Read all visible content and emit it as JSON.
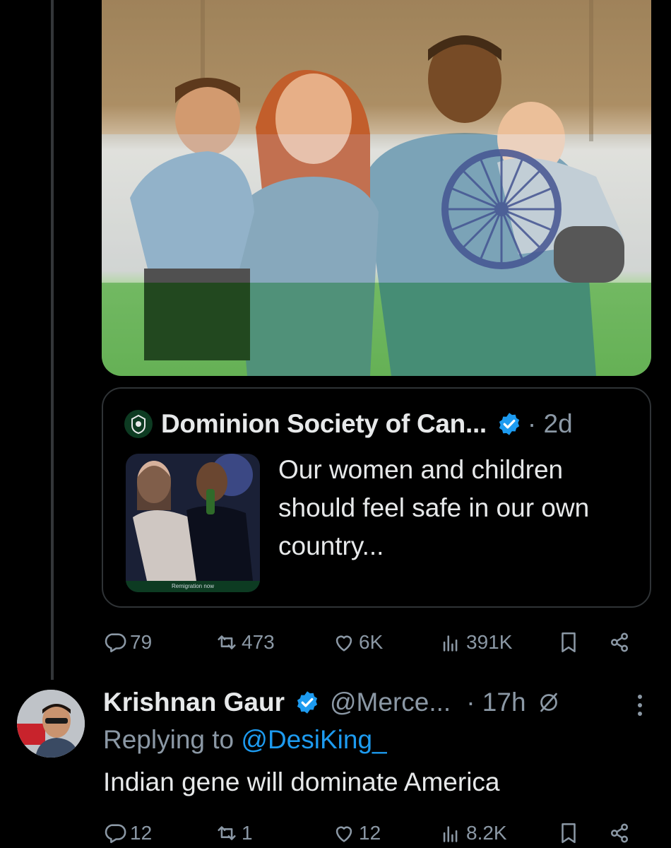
{
  "colors": {
    "background": "#000000",
    "text_primary": "#e7e9ea",
    "text_secondary": "#8b98a5",
    "accent": "#1d9bf0",
    "border": "#2f3336"
  },
  "post": {
    "image_icon": "photo-family-flag-overlay",
    "quote": {
      "author_name": "Dominion Society of Can...",
      "verified_icon": "verified-badge-icon",
      "time": "· 2d",
      "text": "Our women and children should feel safe in our own country...",
      "thumb_caption": "Remigration now"
    },
    "stats": {
      "replies": "79",
      "reposts": "473",
      "likes": "6K",
      "views": "391K"
    }
  },
  "reply": {
    "author_name": "Krishnan Gaur",
    "handle": "@Merce...",
    "time": "· 17h",
    "replying_prefix": "Replying to ",
    "replying_to": "@DesiKing_",
    "text": "Indian gene will dominate America",
    "stats": {
      "replies": "12",
      "reposts": "1",
      "likes": "12",
      "views": "8.2K"
    }
  }
}
